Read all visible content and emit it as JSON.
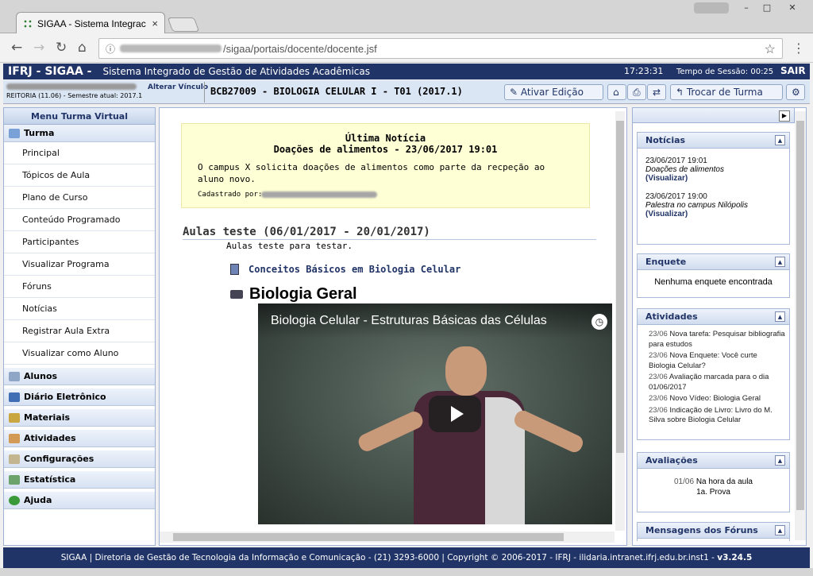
{
  "browser": {
    "tab_title": "SIGAA - Sistema Integrac",
    "tab_close": "×",
    "url_path": "/sigaa/portais/docente/docente.jsf",
    "window_buttons": {
      "minimize": "–",
      "maximize": "□",
      "close": "✕"
    }
  },
  "header": {
    "app_name": "IFRJ - SIGAA -",
    "app_subtitle": "Sistema Integrado de Gestão de Atividades Acadêmicas",
    "clock": "17:23:31",
    "session": "Tempo de Sessão: 00:25",
    "logout": "SAIR"
  },
  "info": {
    "alterar_vinculo": "Alterar Vínculo",
    "reitoria": "REITORIA (11.06) - Semestre atual: 2017.1",
    "course": "BCB27009 - BIOLOGIA CELULAR I - T01 (2017.1)",
    "ativar_edicao": "✎ Ativar Edição",
    "trocar_turma": "↰ Trocar de Turma",
    "icon_home": "⌂",
    "icon_print": "⎙",
    "icon_swap": "⇄",
    "icon_config": "⚙"
  },
  "left_menu": {
    "title": "Menu Turma Virtual",
    "turma": {
      "label": "Turma",
      "items": [
        "Principal",
        "Tópicos de Aula",
        "Plano de Curso",
        "Conteúdo Programado",
        "Participantes",
        "Visualizar Programa",
        "Fóruns",
        "Notícias",
        "Registrar Aula Extra",
        "Visualizar como Aluno"
      ]
    },
    "sections": [
      "Alunos",
      "Diário Eletrônico",
      "Materiais",
      "Atividades",
      "Configurações",
      "Estatística",
      "Ajuda"
    ]
  },
  "main": {
    "notice": {
      "title": "Última Notícia",
      "subtitle": "Doações de alimentos - 23/06/2017 19:01",
      "body": "O campus X solicita doações de alimentos como parte da recpeção ao aluno novo.",
      "registered_by": "Cadastrado por:"
    },
    "topic": {
      "title": "Aulas teste (06/01/2017 - 20/01/2017)",
      "description": "Aulas teste para testar.",
      "doc_link": "Conceitos Básicos em Biologia Celular",
      "video_heading": "Biologia Geral",
      "video_title": "Biologia Celular - Estruturas Básicas das Células"
    }
  },
  "right_panel": {
    "noticias": {
      "title": "Notícias",
      "items": [
        {
          "date": "23/06/2017 19:01",
          "title": "Doações de alimentos",
          "link": "(Visualizar)"
        },
        {
          "date": "23/06/2017 19:00",
          "title": "Palestra no campus Nilópolis",
          "link": "(Visualizar)"
        }
      ]
    },
    "enquete": {
      "title": "Enquete",
      "message": "Nenhuma enquete encontrada"
    },
    "atividades": {
      "title": "Atividades",
      "items": [
        {
          "date": "23/06",
          "text": "Nova tarefa: Pesquisar bibliografia para estudos"
        },
        {
          "date": "23/06",
          "text": "Nova Enquete: Você curte Biologia Celular?"
        },
        {
          "date": "23/06",
          "text": "Avaliação marcada para o dia 01/06/2017"
        },
        {
          "date": "23/06",
          "text": "Novo Vídeo: Biologia Geral"
        },
        {
          "date": "23/06",
          "text": "Indicação de Livro: Livro do M. Silva sobre Biologia Celular"
        }
      ]
    },
    "avaliacoes": {
      "title": "Avaliações",
      "date": "01/06",
      "desc": "Na hora da aula",
      "name": "1a. Prova"
    },
    "mensagens": {
      "title": "Mensagens dos Fóruns"
    }
  },
  "footer": {
    "text": "SIGAA | Diretoria de Gestão de Tecnologia da Informação e Comunicação - (21) 3293-6000 | Copyright © 2006-2017 - IFRJ - ilidaria.intranet.ifrj.edu.br.inst1 - ",
    "version": "v3.24.5"
  },
  "colors": {
    "primary": "#213467",
    "notice_bg": "#ffffd5",
    "panel_bg": "#dbe6f5"
  }
}
